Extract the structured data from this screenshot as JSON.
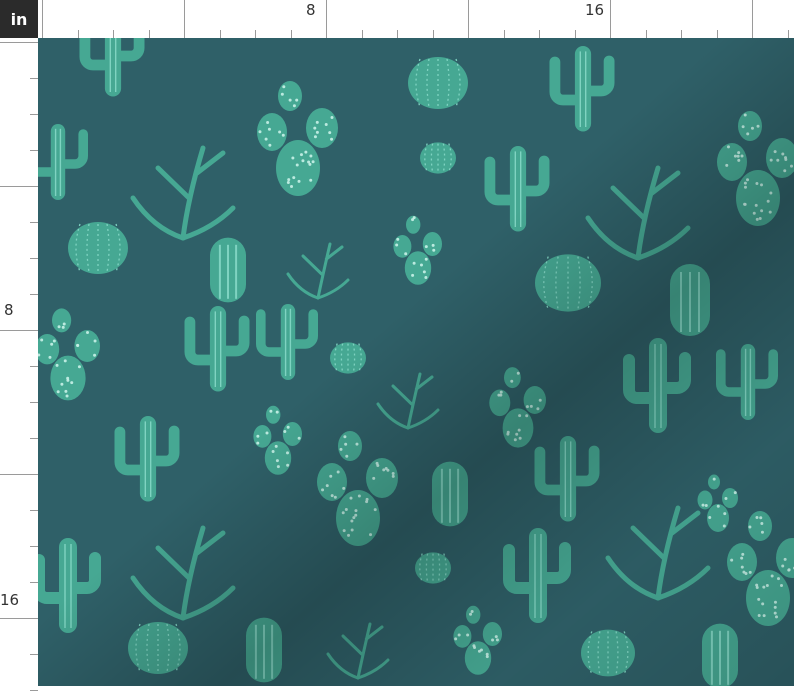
{
  "ruler": {
    "unit": "in",
    "top_labels": [
      "8",
      "16"
    ],
    "left_labels": [
      "8",
      "16"
    ]
  },
  "fabric": {
    "background_color": "#2f6068",
    "cactus_color": "#46a893",
    "cactus_light_color": "#7fd3c1",
    "dot_color": "#c8f1e8"
  }
}
